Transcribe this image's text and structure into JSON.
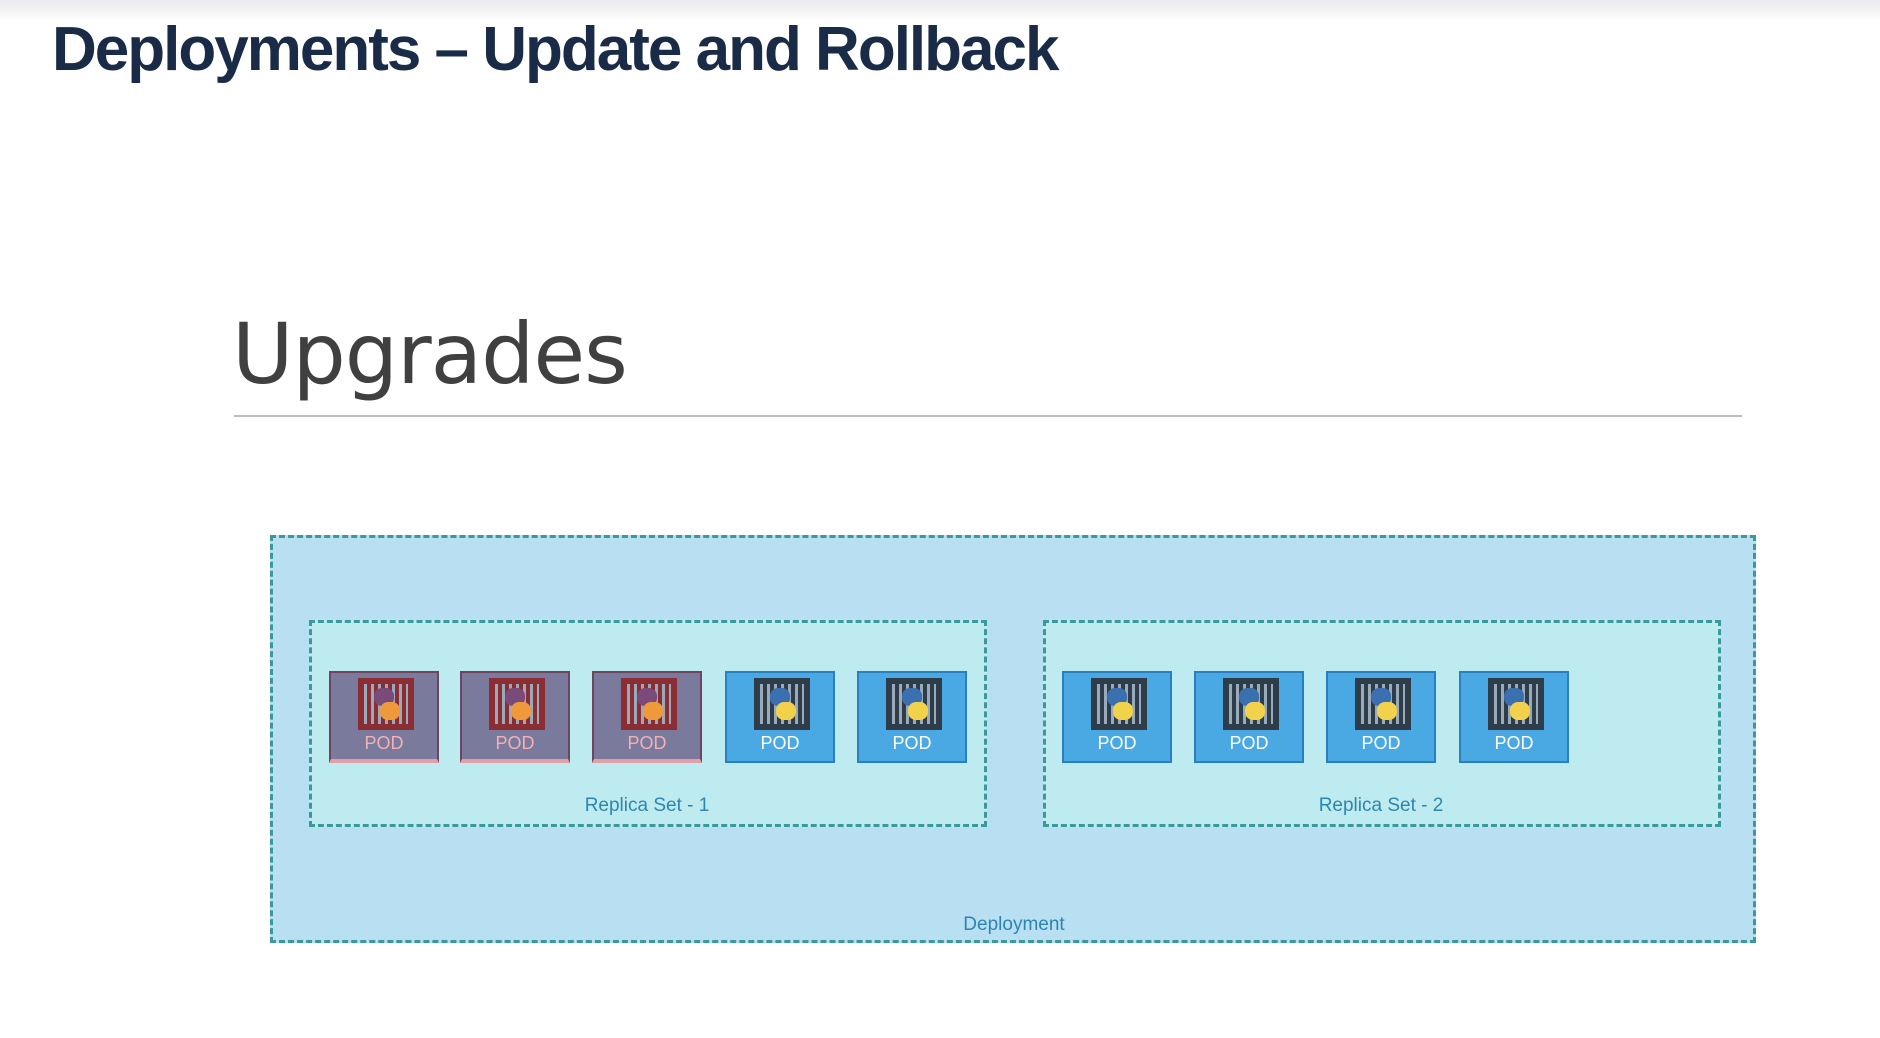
{
  "header": {
    "title": "Deployments – Update and Rollback"
  },
  "slide": {
    "subtitle": "Upgrades",
    "deployment_label": "Deployment",
    "replica_sets": [
      {
        "label": "Replica Set - 1",
        "pods": [
          {
            "label": "POD",
            "state": "old"
          },
          {
            "label": "POD",
            "state": "old"
          },
          {
            "label": "POD",
            "state": "old"
          },
          {
            "label": "POD",
            "state": "new"
          },
          {
            "label": "POD",
            "state": "new"
          }
        ]
      },
      {
        "label": "Replica Set - 2",
        "pods": [
          {
            "label": "POD",
            "state": "new"
          },
          {
            "label": "POD",
            "state": "new"
          },
          {
            "label": "POD",
            "state": "new"
          },
          {
            "label": "POD",
            "state": "new"
          }
        ]
      }
    ]
  },
  "colors": {
    "title": "#1a2b47",
    "deployment_bg": "#b8dff2",
    "replica_set_bg": "#bdebf0",
    "pod_new": "#4aa9e2",
    "pod_old": "#7a7a9c",
    "border": "#3a9a9a"
  }
}
